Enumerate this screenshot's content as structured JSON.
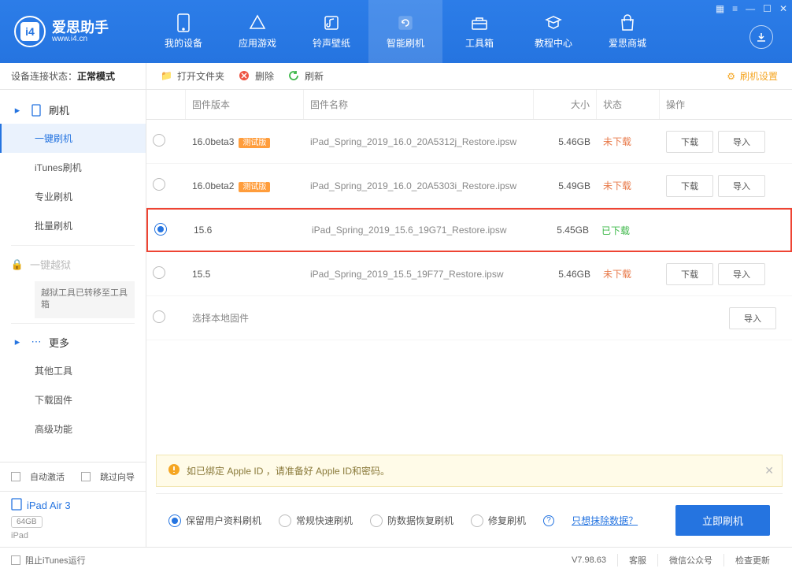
{
  "logo": {
    "title": "爱思助手",
    "subtitle": "www.i4.cn"
  },
  "nav": [
    {
      "label": "我的设备"
    },
    {
      "label": "应用游戏"
    },
    {
      "label": "铃声壁纸"
    },
    {
      "label": "智能刷机"
    },
    {
      "label": "工具箱"
    },
    {
      "label": "教程中心"
    },
    {
      "label": "爱思商城"
    }
  ],
  "sidebar": {
    "status_label": "设备连接状态：",
    "status_value": "正常模式",
    "group_flash": "刷机",
    "items_flash": [
      "一键刷机",
      "iTunes刷机",
      "专业刷机",
      "批量刷机"
    ],
    "group_jail": "一键越狱",
    "jail_note": "越狱工具已转移至工具箱",
    "group_more": "更多",
    "items_more": [
      "其他工具",
      "下载固件",
      "高级功能"
    ],
    "auto_activate": "自动激活",
    "skip_guide": "跳过向导",
    "device_name": "iPad Air 3",
    "device_storage": "64GB",
    "device_type": "iPad"
  },
  "toolbar": {
    "open_folder": "打开文件夹",
    "delete": "删除",
    "refresh": "刷新",
    "settings": "刷机设置"
  },
  "table": {
    "headers": {
      "version": "固件版本",
      "name": "固件名称",
      "size": "大小",
      "status": "状态",
      "action": "操作"
    },
    "rows": [
      {
        "version": "16.0beta3",
        "beta": "测试版",
        "name": "iPad_Spring_2019_16.0_20A5312j_Restore.ipsw",
        "size": "5.46GB",
        "status": "未下载",
        "status_class": "status-undl",
        "selected": false,
        "actions": true
      },
      {
        "version": "16.0beta2",
        "beta": "测试版",
        "name": "iPad_Spring_2019_16.0_20A5303i_Restore.ipsw",
        "size": "5.49GB",
        "status": "未下载",
        "status_class": "status-undl",
        "selected": false,
        "actions": true
      },
      {
        "version": "15.6",
        "beta": "",
        "name": "iPad_Spring_2019_15.6_19G71_Restore.ipsw",
        "size": "5.45GB",
        "status": "已下载",
        "status_class": "status-dl",
        "selected": true,
        "actions": false,
        "highlighted": true
      },
      {
        "version": "15.5",
        "beta": "",
        "name": "iPad_Spring_2019_15.5_19F77_Restore.ipsw",
        "size": "5.46GB",
        "status": "未下载",
        "status_class": "status-undl",
        "selected": false,
        "actions": true
      }
    ],
    "local_firmware": "选择本地固件",
    "download_btn": "下载",
    "import_btn": "导入"
  },
  "notice": "如已绑定 Apple ID ，请准备好 Apple ID和密码。",
  "options": {
    "opt1": "保留用户资料刷机",
    "opt2": "常规快速刷机",
    "opt3": "防数据恢复刷机",
    "opt4": "修复刷机",
    "erase_link": "只想抹除数据？",
    "flash_btn": "立即刷机"
  },
  "footer": {
    "block_itunes": "阻止iTunes运行",
    "version": "V7.98.63",
    "items": [
      "客服",
      "微信公众号",
      "检查更新"
    ]
  }
}
